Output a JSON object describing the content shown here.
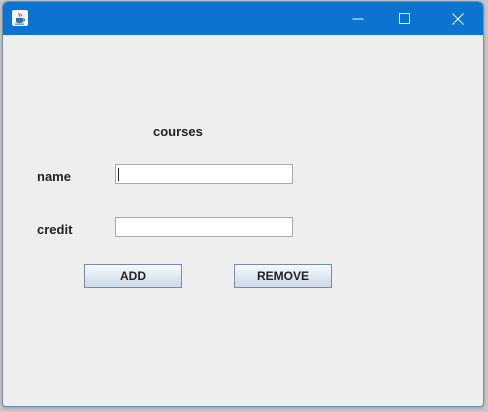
{
  "window": {
    "title": "",
    "app_icon": "java-coffee-cup-icon",
    "controls": {
      "minimize_icon": "minimize-icon",
      "maximize_icon": "maximize-icon",
      "close_icon": "close-icon"
    },
    "titlebar_color": "#0a74d0",
    "background_color": "#eeeeee"
  },
  "form": {
    "heading": "courses",
    "name_label": "name",
    "name_value": "",
    "credit_label": "credit",
    "credit_value": "",
    "add_label": "ADD",
    "remove_label": "REMOVE"
  }
}
